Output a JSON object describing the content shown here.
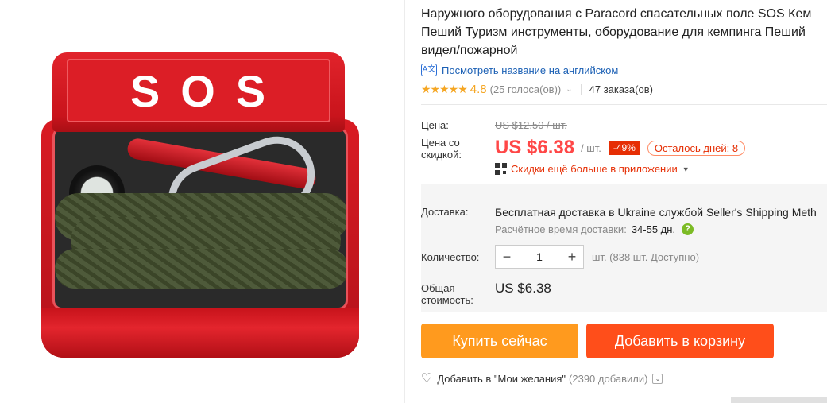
{
  "product": {
    "title_lines": [
      "Наружного оборудования с Paracord спасательных поле SOS Кем",
      "Пеший Туризм инструменты, оборудование для кемпинга Пеший",
      "видел/пожарной"
    ],
    "lid_text": "SOS",
    "image_icon": "sos-survival-tin-image"
  },
  "translate": {
    "icon": "translate-icon",
    "label": "Посмотреть название на английском"
  },
  "rating": {
    "stars": "★★★★★",
    "score": "4.8",
    "votes": "(25 голоса(ов))",
    "orders": "47 заказа(ов)"
  },
  "price": {
    "label": "Цена:",
    "original": "US $12.50 / шт.",
    "discount_label": "Цена со скидкой:",
    "current": "US $6.38",
    "unit": "/ шт.",
    "discount_badge": "-49%",
    "days_left": "Осталось дней: 8",
    "app_deal": "Скидки ещё больше в приложении"
  },
  "shipping": {
    "label": "Доставка:",
    "text": "Бесплатная доставка в Ukraine службой Seller's Shipping Meth",
    "time_label": "Расчётное время доставки:",
    "time_value": "34-55 дн."
  },
  "quantity": {
    "label": "Количество:",
    "minus": "−",
    "value": "1",
    "plus": "+",
    "stock": "шт. (838 шт. Доступно)"
  },
  "total": {
    "label": "Общая стоимость:",
    "value": "US $6.38"
  },
  "actions": {
    "buy_now": "Купить сейчас",
    "add_to_cart": "Добавить в корзину",
    "wishlist": "Добавить в \"Мои желания\"",
    "wishlist_count": "(2390 добавили)"
  },
  "colors": {
    "price_red": "#ff4747",
    "buy_orange": "#ff9a1e",
    "cart_orange": "#ff4e1a",
    "star_gold": "#f5a623",
    "link_blue": "#1a5fb4"
  }
}
